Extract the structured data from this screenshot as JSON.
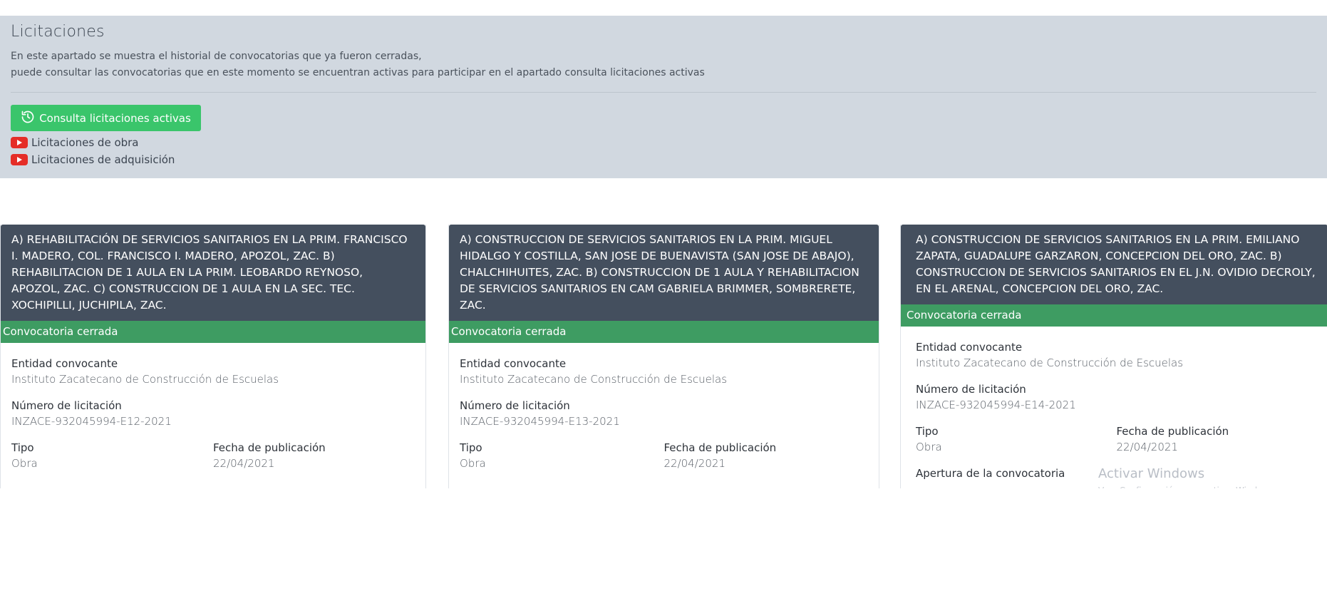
{
  "header": {
    "title": "Licitaciones",
    "description_line1": "En este apartado se muestra el historial de convocatorias que ya fueron cerradas,",
    "description_line2": "puede consultar las convocatorias que en este momento se encuentran activas para participar en el apartado consulta licitaciones activas",
    "active_button_label": "Consulta licitaciones activas",
    "video_links": [
      {
        "label": "Licitaciones de obra",
        "icon": "youtube-icon"
      },
      {
        "label": "Licitaciones de adquisición",
        "icon": "youtube-icon"
      }
    ]
  },
  "colors": {
    "hero_bg": "#d1d8e0",
    "button_green": "#3ac56b",
    "card_header": "#444f5e",
    "status_green": "#3e9c62",
    "youtube_red": "#e52d27"
  },
  "cards": [
    {
      "title": "A) REHABILITACIÓN DE SERVICIOS SANITARIOS EN LA PRIM. FRANCISCO I. MADERO, COL. FRANCISCO I. MADERO, APOZOL, ZAC. B) REHABILITACION DE 1 AULA EN LA PRIM. LEOBARDO REYNOSO, APOZOL, ZAC. C) CONSTRUCCION DE 1 AULA EN LA SEC. TEC. XOCHIPILLI, JUCHIPILA, ZAC.",
      "status": "Convocatoria cerrada",
      "entidad_label": "Entidad convocante",
      "entidad_value": "Instituto Zacatecano de Construcción de Escuelas",
      "numero_label": "Número de licitación",
      "numero_value": "INZACE-932045994-E12-2021",
      "tipo_label": "Tipo",
      "tipo_value": "Obra",
      "fecha_label": "Fecha de publicación",
      "fecha_value": "22/04/2021"
    },
    {
      "title": "A) CONSTRUCCION DE SERVICIOS SANITARIOS EN LA PRIM. MIGUEL HIDALGO Y COSTILLA, SAN JOSE DE BUENAVISTA (SAN JOSE DE ABAJO), CHALCHIHUITES, ZAC. B) CONSTRUCCION DE 1 AULA Y REHABILITACION DE SERVICIOS SANITARIOS EN CAM GABRIELA BRIMMER, SOMBRERETE, ZAC.",
      "status": "Convocatoria cerrada",
      "entidad_label": "Entidad convocante",
      "entidad_value": "Instituto Zacatecano de Construcción de Escuelas",
      "numero_label": "Número de licitación",
      "numero_value": "INZACE-932045994-E13-2021",
      "tipo_label": "Tipo",
      "tipo_value": "Obra",
      "fecha_label": "Fecha de publicación",
      "fecha_value": "22/04/2021"
    },
    {
      "title": "A) CONSTRUCCION DE SERVICIOS SANITARIOS EN LA PRIM. EMILIANO ZAPATA, GUADALUPE GARZARON, CONCEPCION DEL ORO, ZAC. B) CONSTRUCCION DE SERVICIOS SANITARIOS EN EL J.N. OVIDIO DECROLY, EN EL ARENAL, CONCEPCION DEL ORO, ZAC.",
      "status": "Convocatoria cerrada",
      "entidad_label": "Entidad convocante",
      "entidad_value": "Instituto Zacatecano de Construcción de Escuelas",
      "numero_label": "Número de licitación",
      "numero_value": "INZACE-932045994-E14-2021",
      "tipo_label": "Tipo",
      "tipo_value": "Obra",
      "fecha_label": "Fecha de publicación",
      "fecha_value": "22/04/2021",
      "apertura_label": "Apertura de la convocatoria"
    }
  ],
  "watermark": {
    "line1": "Activar Windows",
    "line2": "Ve a Configuración para activar Windows."
  }
}
